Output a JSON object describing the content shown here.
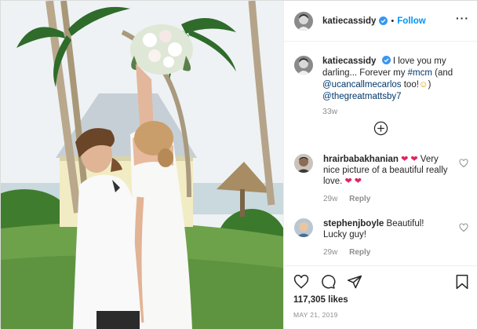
{
  "header": {
    "username": "katiecassidy",
    "dot": "•",
    "follow_label": "Follow"
  },
  "caption": {
    "username": "katiecassidy",
    "text_1": "I love you my darling... Forever my",
    "hashtag": "#mcm",
    "text_2": "(and",
    "mention_1": "@ucancallmecarlos",
    "text_3": "too!",
    "emoji": "☺",
    "text_4": ")",
    "mention_2": "@thegreatmattsby7",
    "time": "33w"
  },
  "comments": [
    {
      "username": "hrairbabakhanian",
      "text": "Very nice picture of a beautiful really love.",
      "hearts_1": "❤ ❤",
      "hearts_2": "❤ ❤",
      "time": "29w",
      "reply_label": "Reply"
    },
    {
      "username": "stephenjboyle",
      "text": "Beautiful! Lucky guy!",
      "time": "29w",
      "reply_label": "Reply"
    }
  ],
  "footer": {
    "likes": "117,305 likes",
    "date": "MAY 21, 2019"
  },
  "colors": {
    "accent": "#0095f6",
    "link": "#00376b",
    "muted": "#8e8e8e",
    "heart": "#e0245e"
  },
  "icons": [
    "verified-badge-icon",
    "more-options-icon",
    "load-more-comments-icon",
    "like-icon",
    "comment-icon",
    "share-icon",
    "bookmark-icon"
  ]
}
